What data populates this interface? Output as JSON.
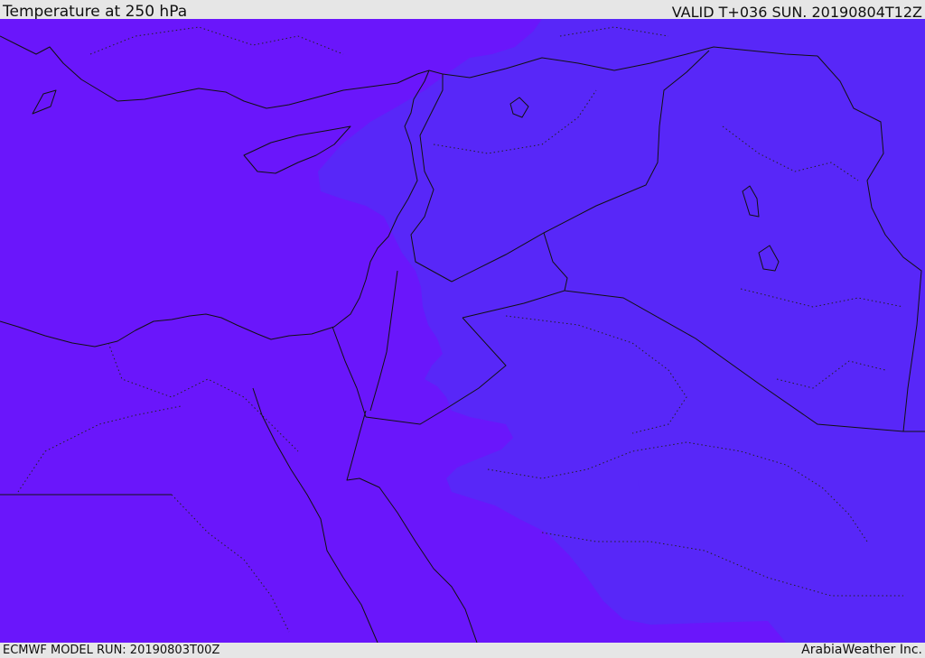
{
  "header": {
    "title": "Temperature at 250 hPa",
    "valid": "VALID T+036 SUN. 20190804T12Z"
  },
  "footer": {
    "model_run": "ECMWF MODEL RUN: 20190803T00Z",
    "credit": "ArabiaWeather Inc."
  },
  "colors": {
    "warmer_shade": "#6a16fb",
    "cooler_shade": "#5827f8",
    "outline": "#111111",
    "bar_background": "#e6e6e6"
  }
}
